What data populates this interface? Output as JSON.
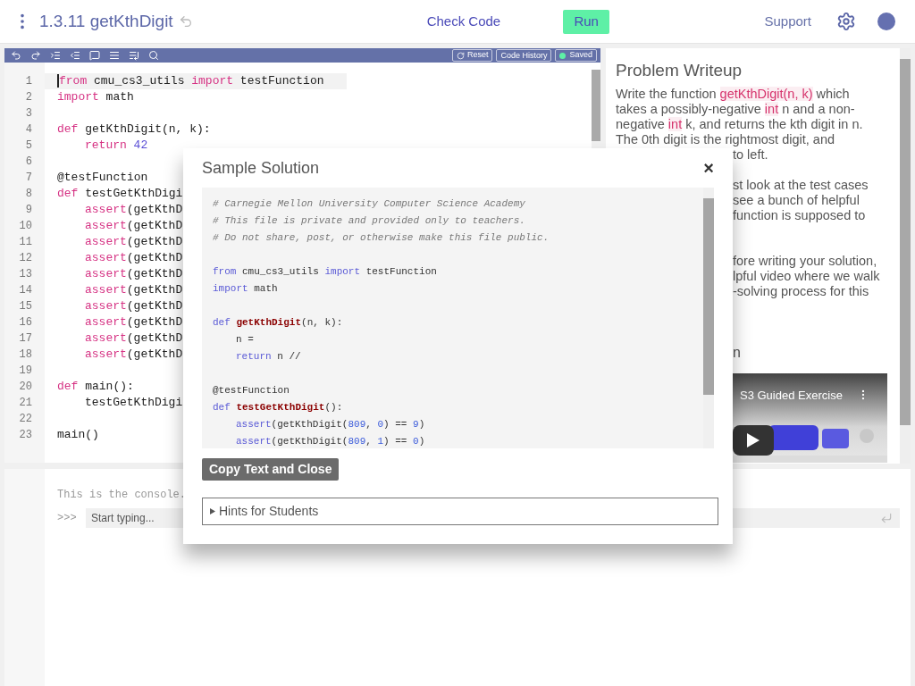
{
  "header": {
    "title": "1.3.11 getKthDigit",
    "check_button": "Check Code",
    "run_button": "Run",
    "support_link": "Support"
  },
  "toolbar": {
    "reset": "Reset",
    "history": "Code History",
    "saved": "Saved"
  },
  "editor": {
    "lines": [
      {
        "number": "1",
        "active": true,
        "indent": false,
        "tokens": [
          {
            "kind": "kw",
            "text": "from"
          },
          {
            "kind": "plain",
            "text": " cmu_cs3_utils "
          },
          {
            "kind": "kw",
            "text": "import"
          },
          {
            "kind": "plain",
            "text": " testFunction"
          }
        ]
      },
      {
        "number": "2",
        "active": false,
        "indent": false,
        "tokens": [
          {
            "kind": "kw",
            "text": "import"
          },
          {
            "kind": "plain",
            "text": " math"
          }
        ]
      },
      {
        "number": "3",
        "active": false
      },
      {
        "number": "4",
        "active": false,
        "indent": false,
        "tokens": [
          {
            "kind": "kw",
            "text": "def"
          },
          {
            "kind": "plain",
            "text": " getKthDigit(n, k):"
          }
        ]
      },
      {
        "number": "5",
        "active": false,
        "indent": true,
        "tokens": [
          {
            "kind": "kw",
            "text": "return"
          },
          {
            "kind": "num",
            "text": " 42"
          }
        ]
      },
      {
        "number": "6",
        "active": false
      },
      {
        "number": "7",
        "active": false,
        "indent": false,
        "tokens": [
          {
            "kind": "plain",
            "text": "@testFunction"
          }
        ]
      },
      {
        "number": "8",
        "active": false,
        "indent": false,
        "tokens": [
          {
            "kind": "kw",
            "text": "def"
          },
          {
            "kind": "plain",
            "text": " testGetKthDigi"
          }
        ]
      },
      {
        "number": "9",
        "active": false,
        "indent": true,
        "tokens": [
          {
            "kind": "kw",
            "text": "assert"
          },
          {
            "kind": "plain",
            "text": "(getKthD"
          }
        ]
      },
      {
        "number": "10",
        "active": false,
        "indent": true,
        "tokens": [
          {
            "kind": "kw",
            "text": "assert"
          },
          {
            "kind": "plain",
            "text": "(getKthD"
          }
        ]
      },
      {
        "number": "11",
        "active": false,
        "indent": true,
        "tokens": [
          {
            "kind": "kw",
            "text": "assert"
          },
          {
            "kind": "plain",
            "text": "(getKthD"
          }
        ]
      },
      {
        "number": "12",
        "active": false,
        "indent": true,
        "tokens": [
          {
            "kind": "kw",
            "text": "assert"
          },
          {
            "kind": "plain",
            "text": "(getKthD"
          }
        ]
      },
      {
        "number": "13",
        "active": false,
        "indent": true,
        "tokens": [
          {
            "kind": "kw",
            "text": "assert"
          },
          {
            "kind": "plain",
            "text": "(getKthD"
          }
        ]
      },
      {
        "number": "14",
        "active": false,
        "indent": true,
        "tokens": [
          {
            "kind": "kw",
            "text": "assert"
          },
          {
            "kind": "plain",
            "text": "(getKthD"
          }
        ]
      },
      {
        "number": "15",
        "active": false,
        "indent": true,
        "tokens": [
          {
            "kind": "kw",
            "text": "assert"
          },
          {
            "kind": "plain",
            "text": "(getKthD"
          }
        ]
      },
      {
        "number": "16",
        "active": false,
        "indent": true,
        "tokens": [
          {
            "kind": "kw",
            "text": "assert"
          },
          {
            "kind": "plain",
            "text": "(getKthD"
          }
        ]
      },
      {
        "number": "17",
        "active": false,
        "indent": true,
        "tokens": [
          {
            "kind": "kw",
            "text": "assert"
          },
          {
            "kind": "plain",
            "text": "(getKthD"
          }
        ]
      },
      {
        "number": "18",
        "active": false,
        "indent": true,
        "tokens": [
          {
            "kind": "kw",
            "text": "assert"
          },
          {
            "kind": "plain",
            "text": "(getKthD"
          }
        ]
      },
      {
        "number": "19",
        "active": false
      },
      {
        "number": "20",
        "active": false,
        "indent": false,
        "tokens": [
          {
            "kind": "kw",
            "text": "def"
          },
          {
            "kind": "plain",
            "text": " main():"
          }
        ]
      },
      {
        "number": "21",
        "active": false,
        "indent": true,
        "tokens": [
          {
            "kind": "plain",
            "text": "testGetKthDigi"
          }
        ]
      },
      {
        "number": "22",
        "active": false
      },
      {
        "number": "23",
        "active": false,
        "indent": false,
        "tokens": [
          {
            "kind": "plain",
            "text": "main()"
          }
        ]
      }
    ]
  },
  "writeup": {
    "title": "Problem Writeup",
    "lines": [
      [
        {
          "kind": "plain",
          "text": "Write the function "
        },
        {
          "kind": "code",
          "text": "getKthDigit(n, k)"
        },
        {
          "kind": "plain",
          "text": " which"
        }
      ],
      [
        {
          "kind": "plain",
          "text": "takes a possibly-negative "
        },
        {
          "kind": "code",
          "text": "int"
        },
        {
          "kind": "plain",
          "text": " n and a non-"
        }
      ],
      [
        {
          "kind": "plain",
          "text": "negative "
        },
        {
          "kind": "code",
          "text": "int"
        },
        {
          "kind": "plain",
          "text": " k, and returns the kth digit in n."
        }
      ],
      [
        {
          "kind": "plain",
          "text": "The 0th digit is the rightmost digit, and"
        }
      ]
    ],
    "fragments": [
      [
        "to left."
      ],
      [
        "st look at the test cases",
        "see a bunch of helpful",
        "function is supposed to"
      ],
      [
        "fore writing your solution,",
        "lpful video where we walk",
        "-solving process for this"
      ],
      [
        "n"
      ]
    ],
    "video": {
      "title": "S3 Guided Exercise"
    }
  },
  "console": {
    "intro": "This is the console.",
    "prompt": ">>>",
    "placeholder": "Start typing..."
  },
  "modal": {
    "title": "Sample Solution",
    "close": "×",
    "code_blocks": [
      [
        {
          "indent": false,
          "tokens": [
            {
              "kind": "comment",
              "text": "# Carnegie Mellon University Computer Science Academy"
            }
          ]
        },
        {
          "indent": false,
          "tokens": [
            {
              "kind": "comment",
              "text": "# This file is private and provided only to teachers."
            }
          ]
        },
        {
          "indent": false,
          "tokens": [
            {
              "kind": "comment",
              "text": "# Do not share, post, or otherwise make this file public."
            }
          ]
        }
      ],
      [
        {
          "indent": false,
          "tokens": [
            {
              "kind": "kw",
              "text": "from"
            },
            {
              "kind": "plain",
              "text": " cmu_cs3_utils "
            },
            {
              "kind": "kw",
              "text": "import"
            },
            {
              "kind": "plain",
              "text": " testFunction"
            }
          ]
        },
        {
          "indent": false,
          "tokens": [
            {
              "kind": "kw",
              "text": "import"
            },
            {
              "kind": "plain",
              "text": " math"
            }
          ]
        }
      ],
      [
        {
          "indent": false,
          "tokens": [
            {
              "kind": "kw",
              "text": "def "
            },
            {
              "kind": "fn",
              "text": "getKthDigit"
            },
            {
              "kind": "plain",
              "text": "(n, k):"
            }
          ]
        },
        {
          "indent": true,
          "tokens": [
            {
              "kind": "plain",
              "text": "n ="
            }
          ]
        },
        {
          "indent": true,
          "tokens": [
            {
              "kind": "kw",
              "text": "return"
            },
            {
              "kind": "plain",
              "text": " n //"
            }
          ]
        }
      ],
      [
        {
          "indent": false,
          "tokens": [
            {
              "kind": "plain",
              "text": "@testFunction"
            }
          ]
        },
        {
          "indent": false,
          "tokens": [
            {
              "kind": "kw",
              "text": "def "
            },
            {
              "kind": "fn",
              "text": "testGetKthDigit"
            },
            {
              "kind": "plain",
              "text": "():"
            }
          ]
        },
        {
          "indent": true,
          "tokens": [
            {
              "kind": "kw",
              "text": "assert"
            },
            {
              "kind": "plain",
              "text": "(getKthDigit("
            },
            {
              "kind": "num",
              "text": "809"
            },
            {
              "kind": "plain",
              "text": ", "
            },
            {
              "kind": "num",
              "text": "0"
            },
            {
              "kind": "plain",
              "text": ") == "
            },
            {
              "kind": "num",
              "text": "9"
            },
            {
              "kind": "plain",
              "text": ")"
            }
          ]
        },
        {
          "indent": true,
          "tokens": [
            {
              "kind": "kw",
              "text": "assert"
            },
            {
              "kind": "plain",
              "text": "(getKthDigit("
            },
            {
              "kind": "num",
              "text": "809"
            },
            {
              "kind": "plain",
              "text": ", "
            },
            {
              "kind": "num",
              "text": "1"
            },
            {
              "kind": "plain",
              "text": ") == "
            },
            {
              "kind": "num",
              "text": "0"
            },
            {
              "kind": "plain",
              "text": ")"
            }
          ]
        }
      ]
    ],
    "copy_button": "Copy Text and Close",
    "hints": "Hints for Students",
    "hints_expanded": false
  }
}
